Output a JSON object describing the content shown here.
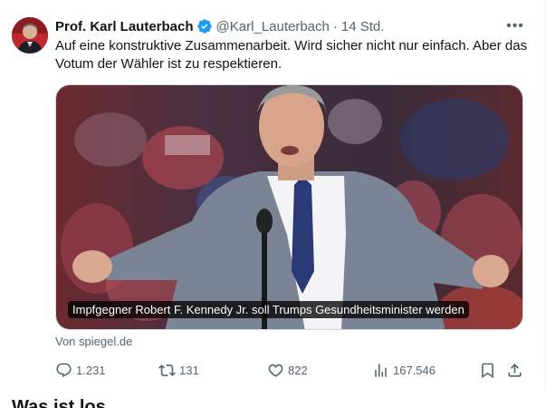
{
  "tweet": {
    "author_name": "Prof. Karl Lauterbach",
    "handle": "@Karl_Lauterbach",
    "separator": "·",
    "time": "14 Std.",
    "more_icon": "more-dots-icon",
    "text": "Auf eine konstruktive Zusammenarbeit. Wird sicher nicht nur einfach. Aber das Votum der Wähler ist zu respektieren.",
    "media_caption": "Impfgegner Robert F. Kennedy Jr. soll Trumps Gesundheitsminister werden",
    "source": "Von spiegel.de",
    "verified_color": "#1d9bf0",
    "actions": {
      "replies": "1.231",
      "reposts": "131",
      "likes": "822",
      "views": "167.546"
    }
  },
  "next_section": {
    "heading": "Was ist los"
  },
  "colors": {
    "text_primary": "#0f1419",
    "text_secondary": "#536471",
    "border": "#cfd9de"
  }
}
